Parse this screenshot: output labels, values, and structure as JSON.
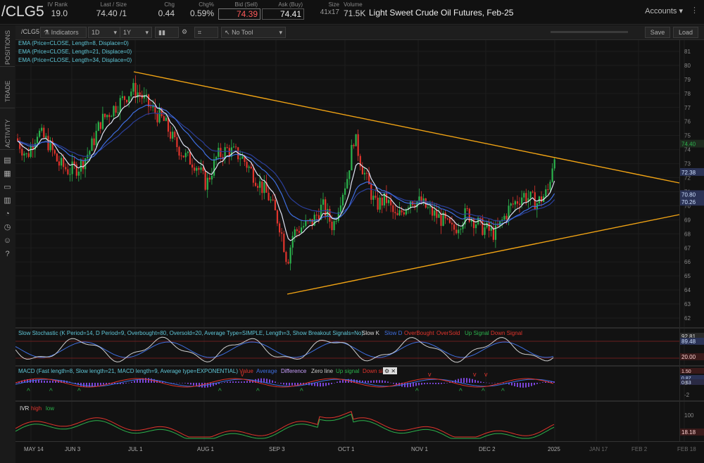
{
  "header": {
    "symbol": "/CLG5",
    "iv_rank": {
      "label": "IV Rank",
      "value": "19.0"
    },
    "last_size": {
      "label": "Last / Size",
      "value": "74.40 /1"
    },
    "chg": {
      "label": "Chg",
      "value": "0.44"
    },
    "chg_pct": {
      "label": "Chg%",
      "value": "0.59%"
    },
    "bid": {
      "label": "Bid (Sell)",
      "value": "74.39"
    },
    "ask": {
      "label": "Ask (Buy)",
      "value": "74.41"
    },
    "size": {
      "label": "Size",
      "value": "41x17"
    },
    "volume": {
      "label": "Volume",
      "value": "71.5K"
    },
    "description": "Light Sweet Crude Oil Futures, Feb-25",
    "accounts": "Accounts"
  },
  "side_tabs": [
    "POSITIONS",
    "TRADE",
    "ACTIVITY"
  ],
  "toolbar": {
    "symbol": "/CLG5",
    "indicators": "Indicators",
    "aggregation": "1D",
    "range": "1Y",
    "tool": "No Tool",
    "save": "Save",
    "load": "Load"
  },
  "price_panel": {
    "studies": [
      "EMA (Price=CLOSE, Length=8, Displace=0)",
      "EMA (Price=CLOSE, Length=21, Displace=0)",
      "EMA (Price=CLOSE, Length=34, Displace=0)"
    ],
    "axis_ticks": [
      "81",
      "80",
      "79",
      "78",
      "77",
      "76",
      "75",
      "74",
      "73",
      "72",
      "71",
      "70",
      "69",
      "68",
      "67",
      "66",
      "65",
      "64",
      "63",
      "62"
    ],
    "price_badges": [
      "74.40",
      "72.38",
      "70.80",
      "70.26"
    ]
  },
  "stochastic": {
    "title": "Slow Stochastic (K Period=14, D Period=9, Overbought=80, Oversold=20, Average Type=SIMPLE, Length=3, Show Breakout Signals=No)",
    "legend": [
      "Slow K",
      "Slow D",
      "OverBought",
      "OverSold",
      "Up Signal",
      "Down Signal"
    ],
    "badges": [
      "92.81",
      "89.48",
      "20.00"
    ]
  },
  "macd": {
    "title": "MACD (Fast length=8, Slow length=21, MACD length=9, Average type=EXPONENTIAL)",
    "legend": [
      "Value",
      "Average",
      "Difference",
      "Zero line",
      "Up signal",
      "Down signal"
    ],
    "badges": [
      "1.50",
      "0.87",
      "0.63"
    ],
    "axis_ticks": [
      "0",
      "-2"
    ]
  },
  "ivr": {
    "legend": [
      "IVR",
      "high",
      "low"
    ],
    "axis_ticks": [
      "100"
    ],
    "badges": [
      "18.18"
    ]
  },
  "x_axis": [
    "MAY 14",
    "JUN 3",
    "JUL 1",
    "AUG 1",
    "SEP 3",
    "OCT 1",
    "NOV 1",
    "DEC 2",
    "JAN 2",
    "2025",
    "JAN 17",
    "FEB 2",
    "FEB 18"
  ],
  "colors": {
    "up": "#2bb24c",
    "down": "#e0342c",
    "trendline": "#f2a414",
    "ema8": "#dfe3f2",
    "ema21": "#3f6fe0",
    "ema34": "#2b3f9a"
  }
}
